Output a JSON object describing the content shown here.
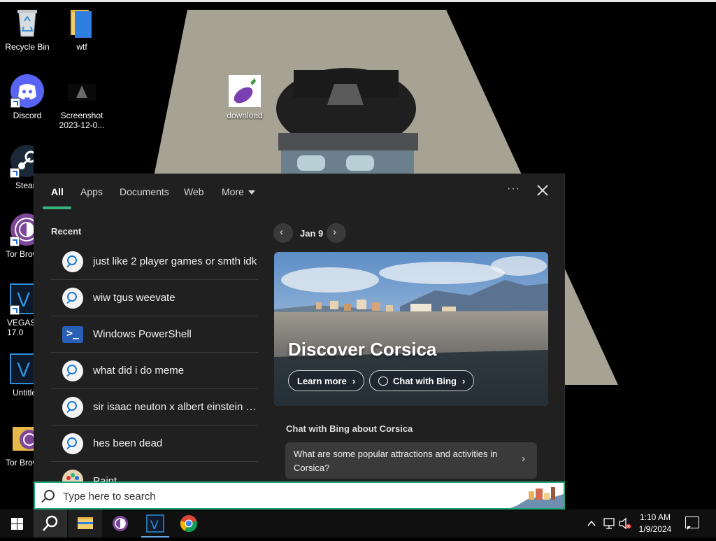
{
  "desktop": {
    "icons": [
      {
        "label": "Recycle Bin"
      },
      {
        "label": "wtf"
      },
      {
        "label": "Discord"
      },
      {
        "label": "Screenshot 2023-12-0..."
      },
      {
        "label": "download"
      },
      {
        "label": "Steam"
      },
      {
        "label": "Tor Browser"
      },
      {
        "label": "VEGAS 17.0"
      },
      {
        "label": "Untitled"
      },
      {
        "label": "Tor Browser"
      }
    ]
  },
  "search_panel": {
    "tabs": [
      {
        "label": "All",
        "active": true
      },
      {
        "label": "Apps"
      },
      {
        "label": "Documents"
      },
      {
        "label": "Web"
      },
      {
        "label": "More"
      }
    ],
    "more_options": "···",
    "recent_title": "Recent",
    "recent_items": [
      {
        "label": "just like 2 player games or smth idk",
        "icon": "search-icon"
      },
      {
        "label": "wiw tgus weevate",
        "icon": "search-icon"
      },
      {
        "label": "Windows PowerShell",
        "icon": "powershell-icon"
      },
      {
        "label": "what did i do meme",
        "icon": "search-icon"
      },
      {
        "label": "sir isaac neuton x albert einstein e...",
        "icon": "search-icon"
      },
      {
        "label": "hes been dead",
        "icon": "search-icon"
      },
      {
        "label": "Paint",
        "icon": "paint-icon"
      }
    ],
    "date_nav": {
      "label": "Jan 9",
      "prev": "‹",
      "next": "›"
    },
    "hero": {
      "title": "Discover Corsica",
      "learn_more": "Learn more",
      "chat_with_bing": "Chat with Bing"
    },
    "chat_section_title": "Chat with Bing about Corsica",
    "suggestion": "What are some popular attractions and activities in Corsica?"
  },
  "search_box": {
    "placeholder": "Type here to search",
    "value": ""
  },
  "taskbar": {
    "time": "1:10 AM",
    "date": "1/9/2024",
    "accent_color": "#1ea878"
  }
}
